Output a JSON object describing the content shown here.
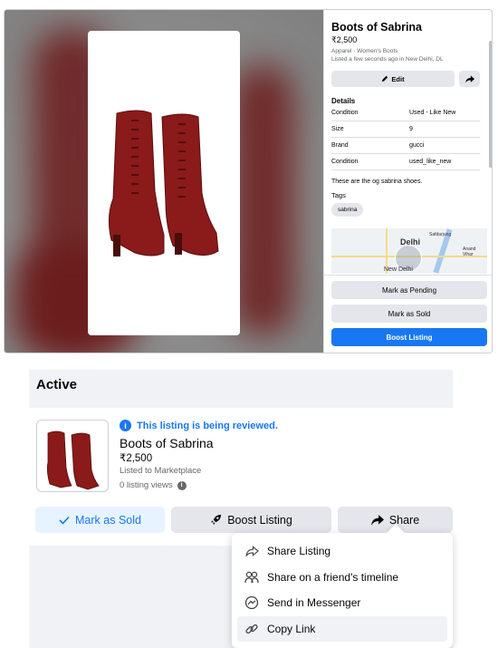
{
  "preview": {
    "title": "Boots of Sabrina",
    "price": "₹2,500",
    "category": "Apparel · Women's Boots",
    "listed": "Listed a few seconds ago in New Delhi, DL",
    "edit_label": "Edit",
    "details_heading": "Details",
    "details": [
      {
        "key": "Condition",
        "value": "Used - Like New"
      },
      {
        "key": "Size",
        "value": "9"
      },
      {
        "key": "Brand",
        "value": "gucci"
      },
      {
        "key": "Condition",
        "value": "used_like_new"
      }
    ],
    "description": "These are the og sabrina shoes.",
    "tags_heading": "Tags",
    "tags": [
      "sabrina"
    ],
    "map": {
      "city": "Delhi",
      "area1": "Safdarjung",
      "area2": "Anand Vihar",
      "area3": "New Delhi"
    },
    "buttons": {
      "pending": "Mark as Pending",
      "sold": "Mark as Sold",
      "boost": "Boost Listing"
    }
  },
  "listing": {
    "section_title": "Active",
    "review_notice": "This listing is being reviewed.",
    "title": "Boots of Sabrina",
    "price": "₹2,500",
    "marketplace": "Listed to Marketplace",
    "views": "0 listing views",
    "buttons": {
      "sold": "Mark as Sold",
      "boost": "Boost Listing",
      "share": "Share"
    }
  },
  "share_menu": {
    "items": [
      {
        "label": "Share Listing",
        "icon": "share-arrow-icon"
      },
      {
        "label": "Share on a friend's timeline",
        "icon": "friends-icon"
      },
      {
        "label": "Send in Messenger",
        "icon": "messenger-icon"
      },
      {
        "label": "Copy Link",
        "icon": "link-icon"
      }
    ]
  },
  "colors": {
    "accent": "#1877f2",
    "button_grey": "#e4e6eb",
    "boot": "#8b1a1a"
  }
}
